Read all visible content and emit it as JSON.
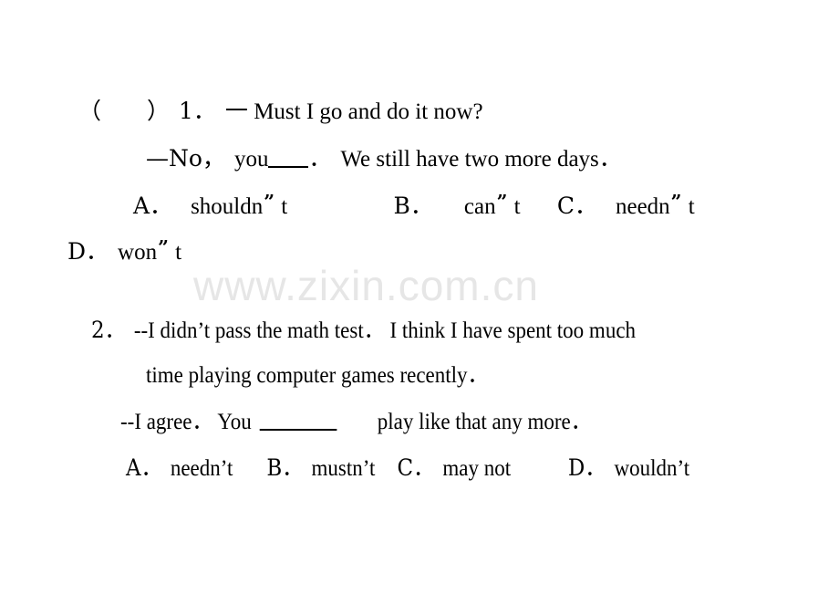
{
  "page": {
    "background_color": "#ffffff",
    "text_color": "#000000"
  },
  "watermark": {
    "text": "www.zixin.com.cn",
    "color": "#e6e6e6"
  },
  "questions": [
    {
      "id": "q1",
      "answer_box": "（　　）",
      "number": "1．",
      "stem_dash": "一",
      "stem": " Must I go and do it now?",
      "reply_prefix": "—No，",
      "reply_word": "you",
      "reply_after_blank": "．",
      "reply_tail": "We still have two more days．",
      "options_row_1": [
        {
          "letter": "A．",
          "text_before_quote": "shouldn",
          "quote": "”",
          "text_after_quote": " t"
        },
        {
          "letter": "B．",
          "text_before_quote": "can",
          "quote": "”",
          "text_after_quote": " t"
        },
        {
          "letter": "C．",
          "text_before_quote": "needn",
          "quote": "”",
          "text_after_quote": " t"
        }
      ],
      "options_row_2": [
        {
          "letter": "D．",
          "text_before_quote": "won",
          "quote": "”",
          "text_after_quote": " t"
        }
      ]
    },
    {
      "id": "q2",
      "number": "2．",
      "stem_line_1": "--I didn’t pass the math test．  I think I have spent too much",
      "stem_line_2": "time playing computer games recently．",
      "reply_prefix": "--I agree．  You",
      "reply_tail": "play like that any more．",
      "options": [
        {
          "letter": "A．",
          "text": "needn’t"
        },
        {
          "letter": "B．",
          "text": "mustn’t"
        },
        {
          "letter": "C．",
          "text": "may not"
        },
        {
          "letter": "D．",
          "text": "wouldn’t"
        }
      ]
    }
  ]
}
